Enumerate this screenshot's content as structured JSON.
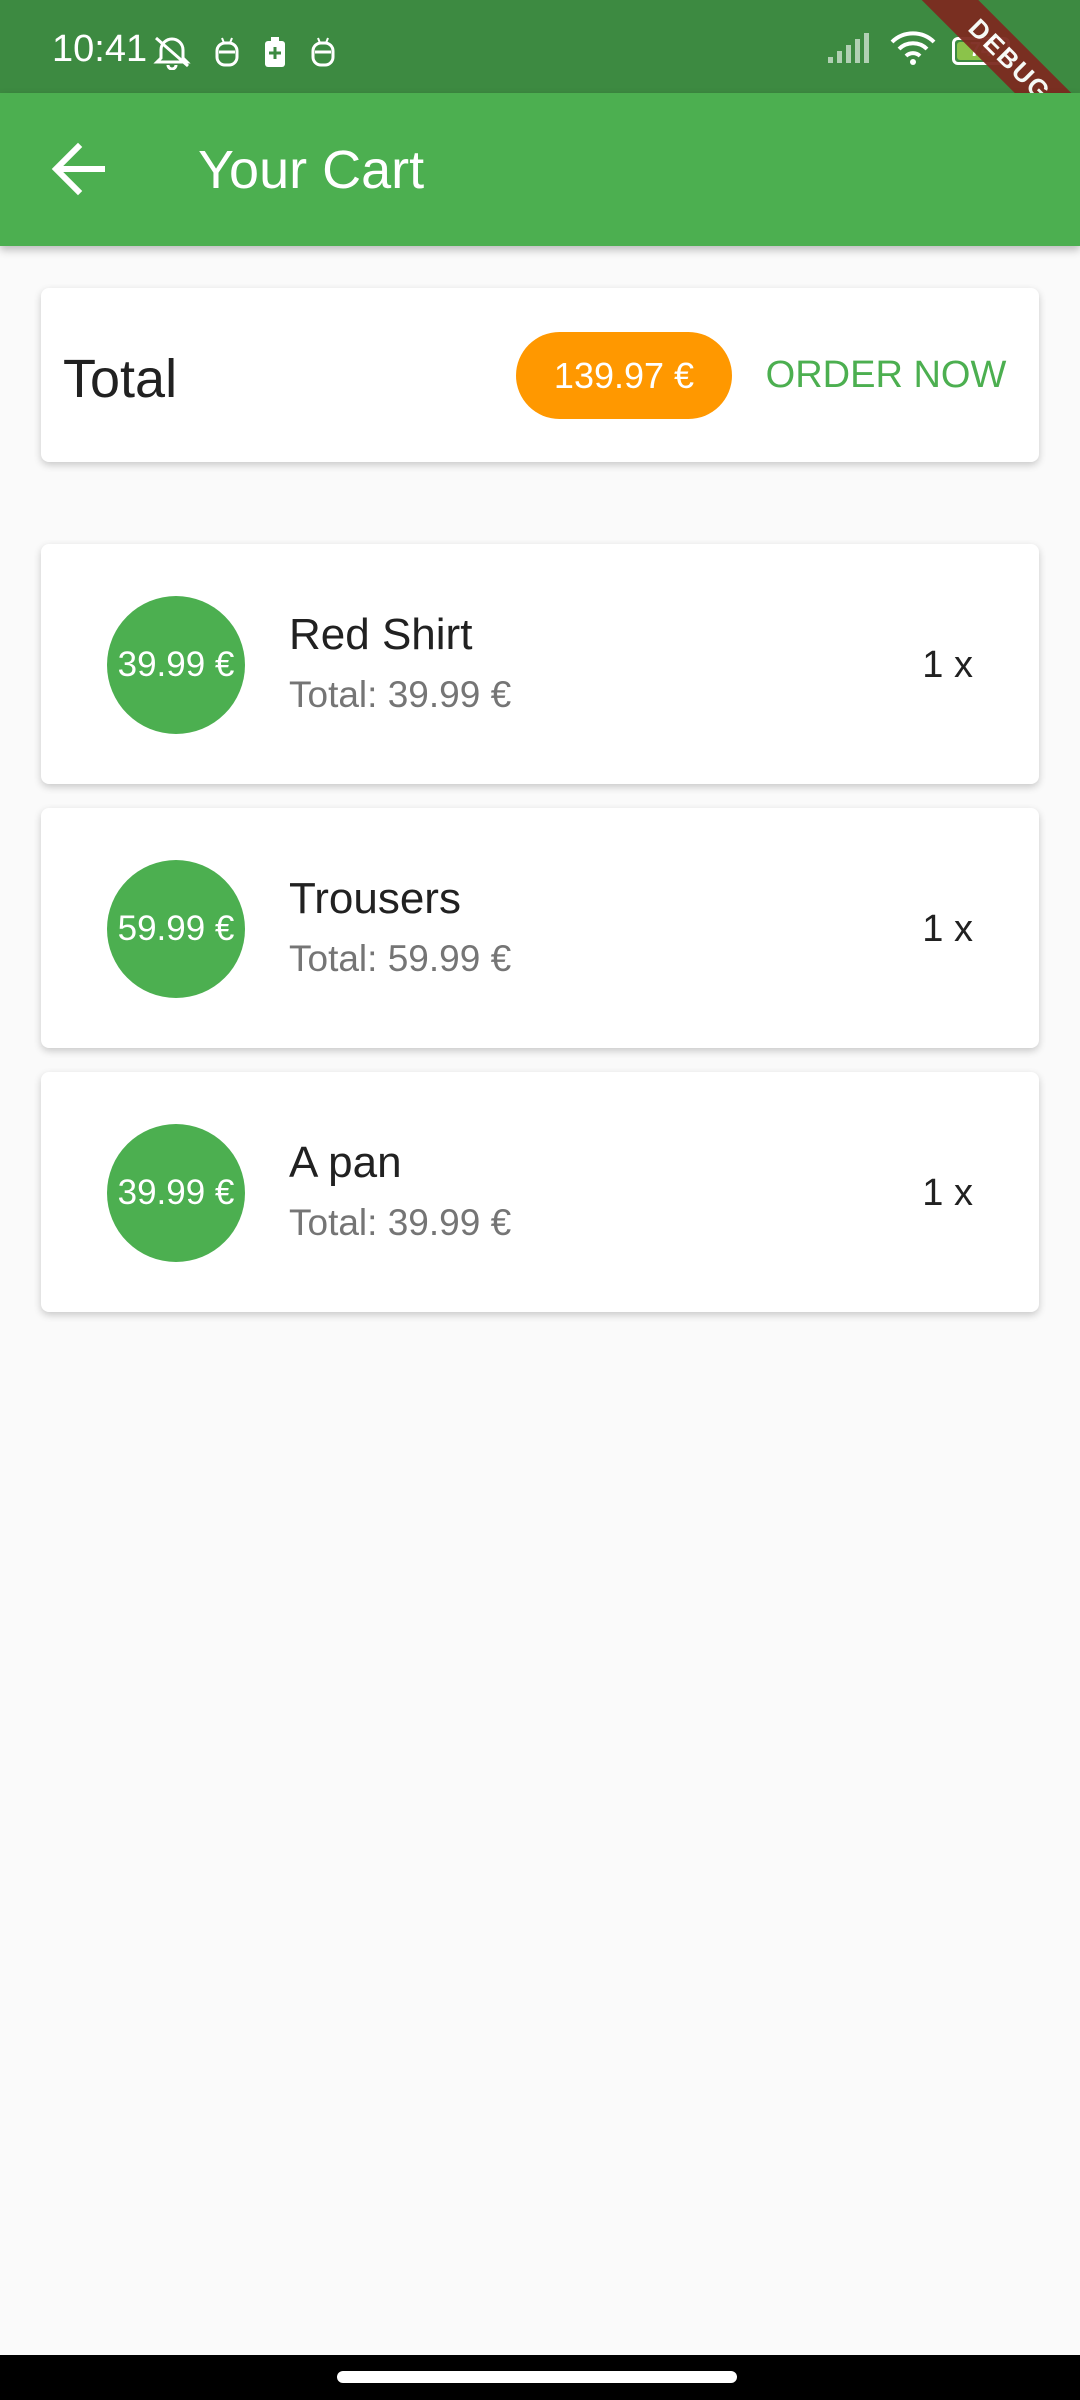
{
  "status_bar": {
    "time": "10:41",
    "battery": "74",
    "battery_level": 0.74,
    "debug_label": "DEBUG"
  },
  "app_bar": {
    "back_icon": "arrow-back-icon",
    "title": "Your Cart"
  },
  "summary": {
    "total_label": "Total",
    "total_amount": "139.97 €",
    "order_button": "ORDER NOW"
  },
  "items": [
    {
      "price": "39.99 €",
      "title": "Red Shirt",
      "subtitle": "Total: 39.99 €",
      "quantity": "1 x"
    },
    {
      "price": "59.99 €",
      "title": "Trousers",
      "subtitle": "Total: 59.99 €",
      "quantity": "1 x"
    },
    {
      "price": "39.99 €",
      "title": "A pan",
      "subtitle": "Total: 39.99 €",
      "quantity": "1 x"
    }
  ],
  "colors": {
    "primary": "#4caf50",
    "status_bar": "#3d8a41",
    "accent": "#ff9800",
    "background": "#fafafa"
  }
}
